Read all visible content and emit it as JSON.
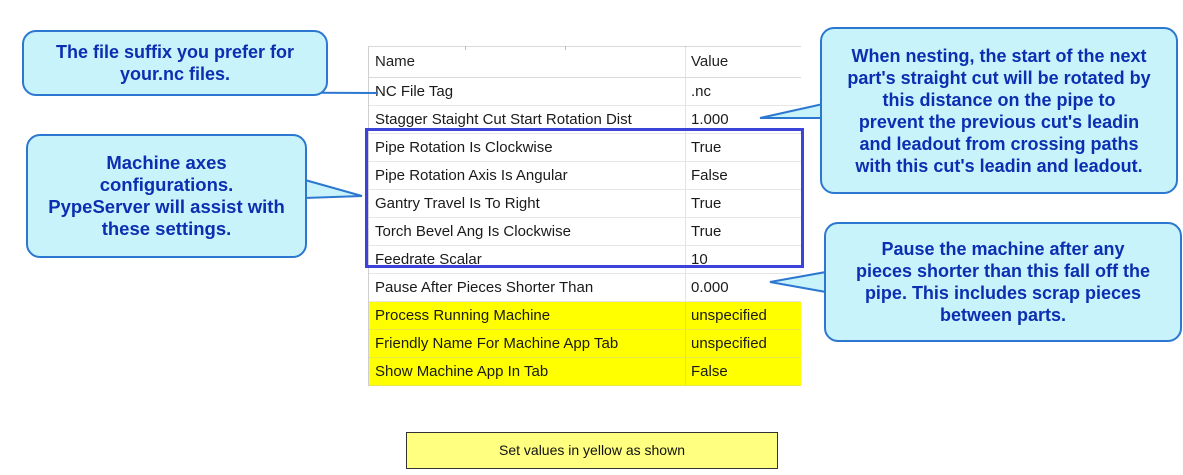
{
  "grid": {
    "header": {
      "name": "Name",
      "value": "Value"
    },
    "rows": [
      {
        "name": "NC File Tag",
        "value": ".nc",
        "highlight": false
      },
      {
        "name": "Stagger Staight Cut Start Rotation Dist",
        "value": "1.000",
        "highlight": false
      },
      {
        "name": "Pipe Rotation Is Clockwise",
        "value": "True",
        "highlight": false
      },
      {
        "name": "Pipe Rotation Axis Is Angular",
        "value": "False",
        "highlight": false
      },
      {
        "name": "Gantry Travel Is To Right",
        "value": "True",
        "highlight": false
      },
      {
        "name": "Torch Bevel Ang Is Clockwise",
        "value": "True",
        "highlight": false
      },
      {
        "name": "Feedrate Scalar",
        "value": "10",
        "highlight": false
      },
      {
        "name": "Pause After Pieces Shorter Than",
        "value": "0.000",
        "highlight": false
      },
      {
        "name": "Process Running Machine",
        "value": "unspecified",
        "highlight": true
      },
      {
        "name": "Friendly Name For Machine App Tab",
        "value": "unspecified",
        "highlight": true
      },
      {
        "name": "Show Machine App In Tab",
        "value": "False",
        "highlight": true
      }
    ]
  },
  "callouts": {
    "file_suffix": [
      "The file suffix you prefer for",
      "your.nc files."
    ],
    "machine_axes": [
      "Machine axes",
      "configurations.",
      "PypeServer will assist with",
      "these settings."
    ],
    "nesting": [
      "When nesting, the start of the next",
      "part's straight cut will be rotated by",
      "this distance on the pipe to",
      "prevent the previous cut's leadin",
      "and leadout from crossing paths",
      "with this cut's leadin and leadout."
    ],
    "pause": [
      "Pause the machine after any",
      "pieces shorter than this fall off the",
      "pipe.  This includes scrap pieces",
      "between parts."
    ]
  },
  "note": "Set values in yellow as shown",
  "colors": {
    "callout_fill": "#c9f3fb",
    "callout_border": "#2c78d0",
    "callout_text": "#0b2fb0",
    "highlight": "#ffff00",
    "group_box": "#3b43d9",
    "note_fill": "#ffff80"
  }
}
